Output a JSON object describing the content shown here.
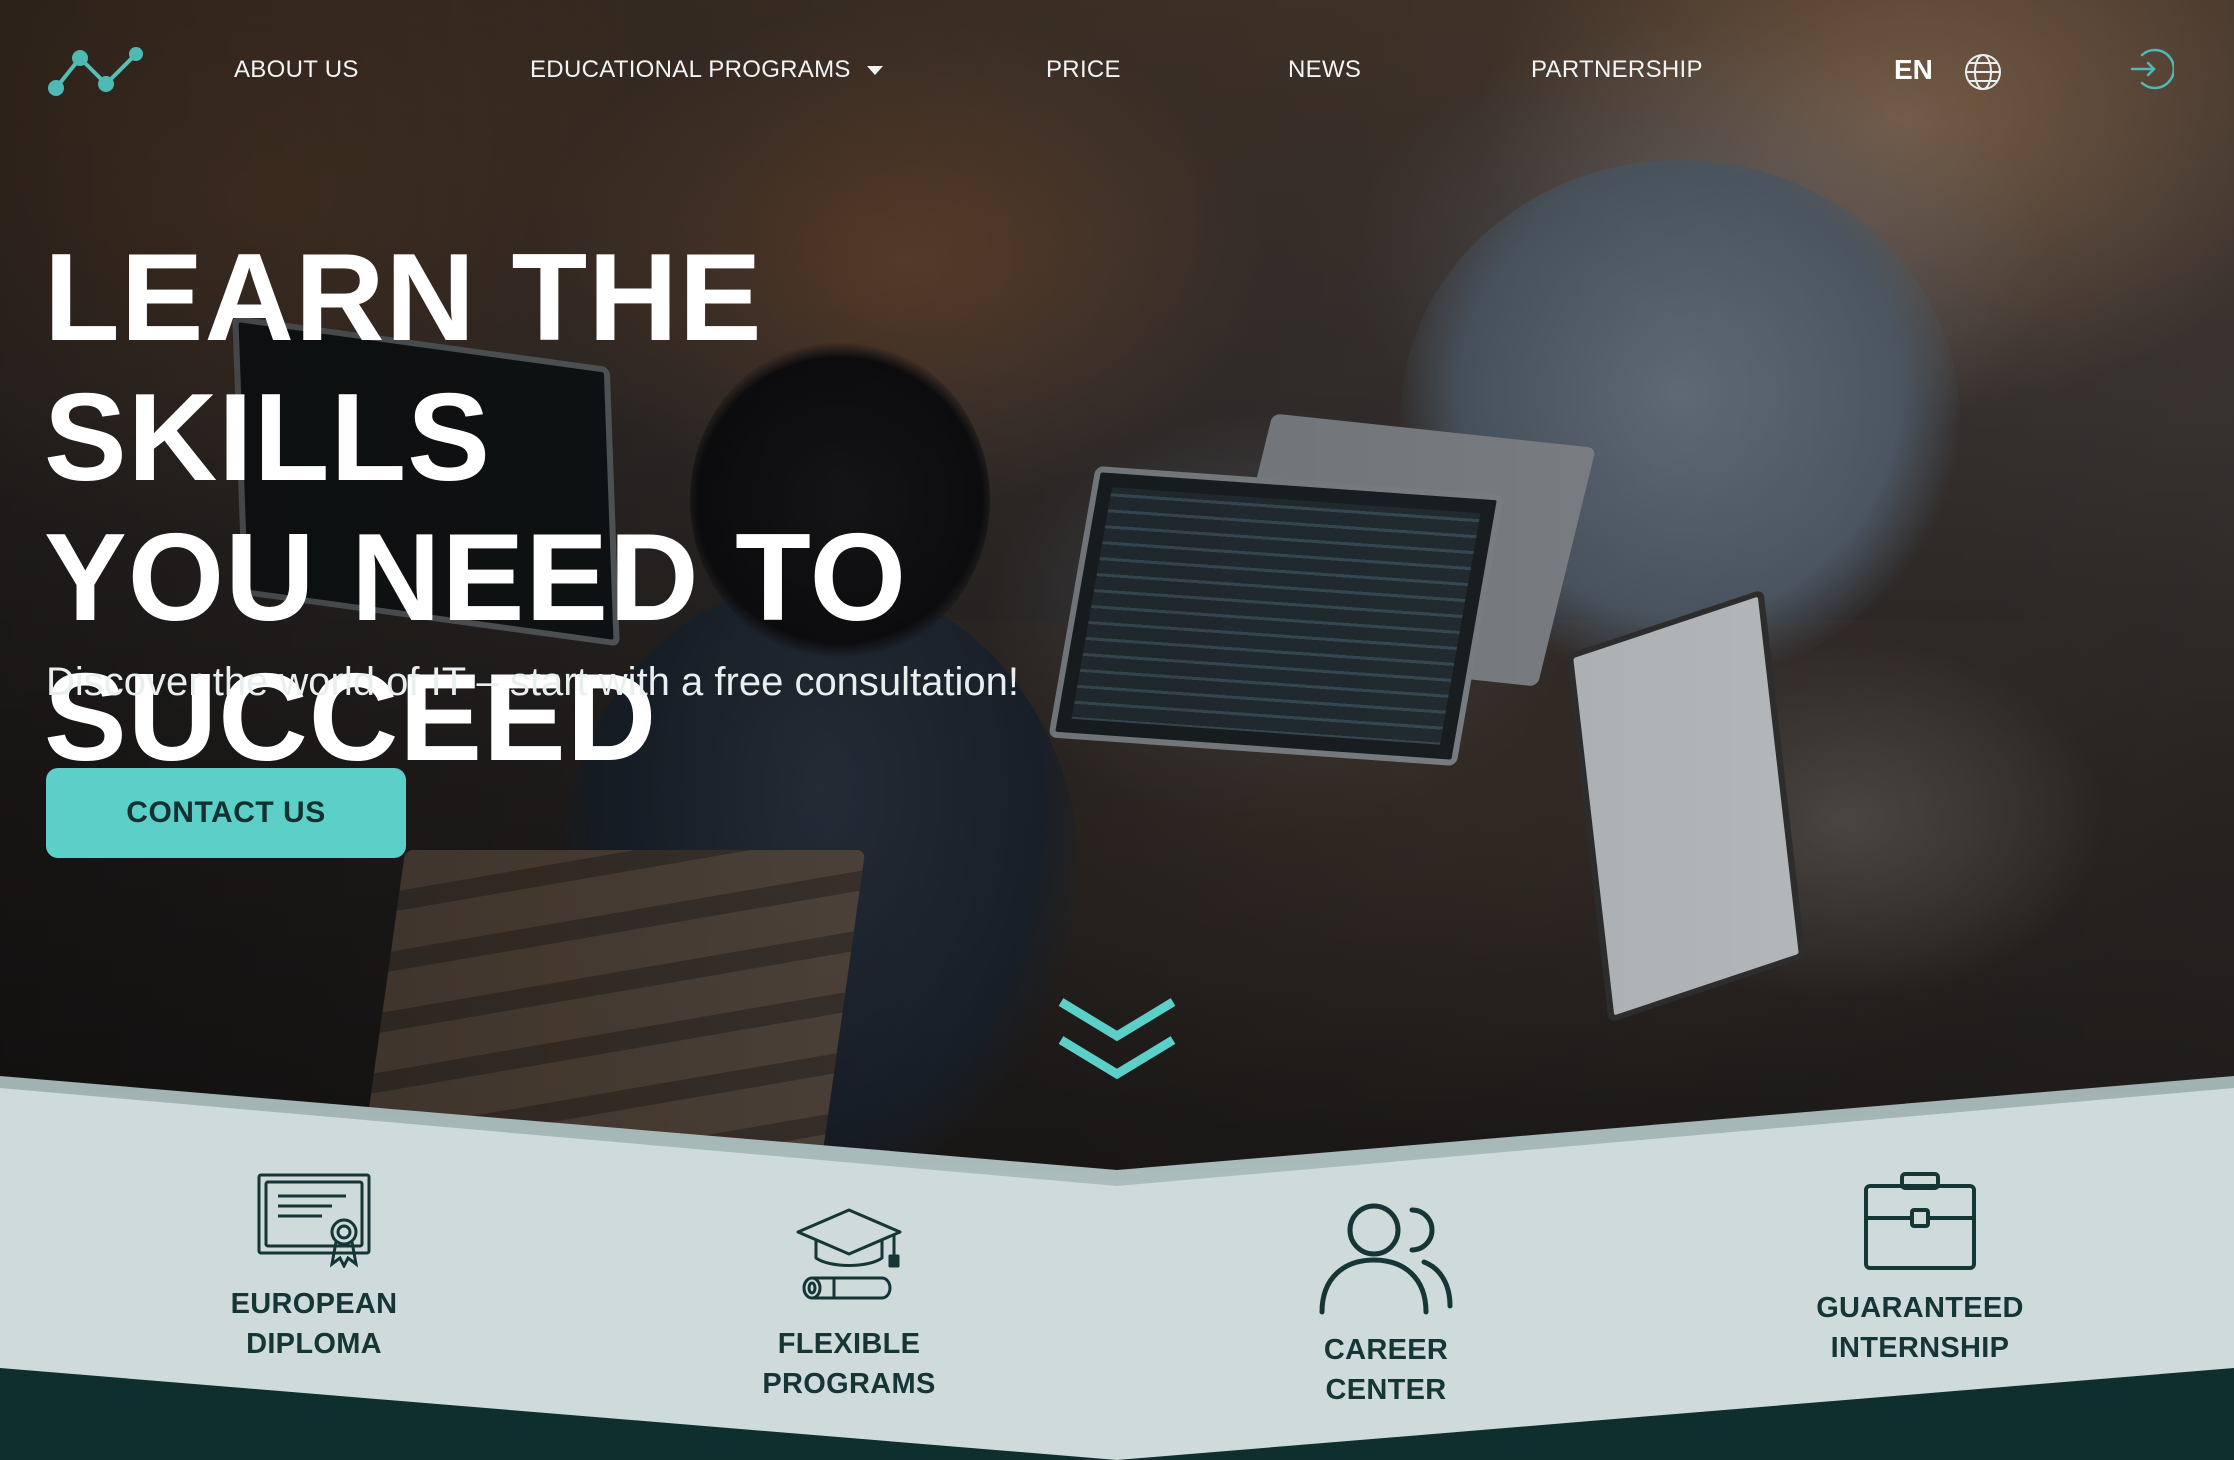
{
  "nav": {
    "items": [
      {
        "label": "ABOUT US"
      },
      {
        "label": "EDUCATIONAL PROGRAMS"
      },
      {
        "label": "PRICE"
      },
      {
        "label": "NEWS"
      },
      {
        "label": "PARTNERSHIP"
      }
    ],
    "language": "EN"
  },
  "hero": {
    "title_lines": [
      "LEARN THE SKILLS",
      "YOU NEED TO",
      "SUCCEED"
    ],
    "subtitle": "Discover the world of IT – start with a free consultation!",
    "cta_label": "CONTACT US"
  },
  "features": [
    {
      "line1": "EUROPEAN",
      "line2": "DIPLOMA",
      "icon": "diploma-icon"
    },
    {
      "line1": "FLEXIBLE",
      "line2": "PROGRAMS",
      "icon": "graduation-cap-icon"
    },
    {
      "line1": "CAREER",
      "line2": "CENTER",
      "icon": "people-icon"
    },
    {
      "line1": "GUARANTEED",
      "line2": "INTERNSHIP",
      "icon": "briefcase-icon"
    }
  ],
  "colors": {
    "accent": "#5ccfc9",
    "feature_band": "#cfdbdb",
    "dark_band": "#0f2e2e",
    "feature_text": "#163636"
  }
}
